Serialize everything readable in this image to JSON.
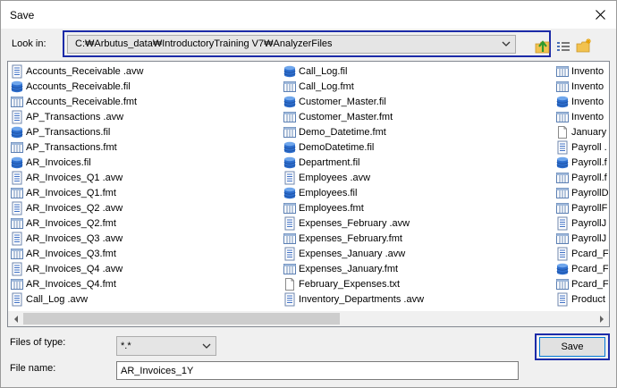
{
  "window": {
    "title": "Save"
  },
  "look_in": {
    "label": "Look in:",
    "path": "C:₩Arbutus_data₩IntroductoryTraining V7₩AnalyzerFiles"
  },
  "files": {
    "col1": [
      {
        "name": "Accounts_Receivable .avw",
        "icon": "view-document-icon"
      },
      {
        "name": "Accounts_Receivable.fil",
        "icon": "database-icon"
      },
      {
        "name": "Accounts_Receivable.fmt",
        "icon": "table-format-icon"
      },
      {
        "name": "AP_Transactions .avw",
        "icon": "view-document-icon"
      },
      {
        "name": "AP_Transactions.fil",
        "icon": "database-icon"
      },
      {
        "name": "AP_Transactions.fmt",
        "icon": "table-format-icon"
      },
      {
        "name": "AR_Invoices.fil",
        "icon": "database-icon"
      },
      {
        "name": "AR_Invoices_Q1 .avw",
        "icon": "view-document-icon"
      },
      {
        "name": "AR_Invoices_Q1.fmt",
        "icon": "table-format-icon"
      },
      {
        "name": "AR_Invoices_Q2 .avw",
        "icon": "view-document-icon"
      },
      {
        "name": "AR_Invoices_Q2.fmt",
        "icon": "table-format-icon"
      },
      {
        "name": "AR_Invoices_Q3 .avw",
        "icon": "view-document-icon"
      },
      {
        "name": "AR_Invoices_Q3.fmt",
        "icon": "table-format-icon"
      },
      {
        "name": "AR_Invoices_Q4 .avw",
        "icon": "view-document-icon"
      },
      {
        "name": "AR_Invoices_Q4.fmt",
        "icon": "table-format-icon"
      },
      {
        "name": "Call_Log .avw",
        "icon": "view-document-icon"
      }
    ],
    "col2": [
      {
        "name": "Call_Log.fil",
        "icon": "database-icon"
      },
      {
        "name": "Call_Log.fmt",
        "icon": "table-format-icon"
      },
      {
        "name": "Customer_Master.fil",
        "icon": "database-icon"
      },
      {
        "name": "Customer_Master.fmt",
        "icon": "table-format-icon"
      },
      {
        "name": "Demo_Datetime.fmt",
        "icon": "table-format-icon"
      },
      {
        "name": "DemoDatetime.fil",
        "icon": "database-icon"
      },
      {
        "name": "Department.fil",
        "icon": "database-icon"
      },
      {
        "name": "Employees .avw",
        "icon": "view-document-icon"
      },
      {
        "name": "Employees.fil",
        "icon": "database-icon"
      },
      {
        "name": "Employees.fmt",
        "icon": "table-format-icon"
      },
      {
        "name": "Expenses_February .avw",
        "icon": "view-document-icon"
      },
      {
        "name": "Expenses_February.fmt",
        "icon": "table-format-icon"
      },
      {
        "name": "Expenses_January .avw",
        "icon": "view-document-icon"
      },
      {
        "name": "Expenses_January.fmt",
        "icon": "table-format-icon"
      },
      {
        "name": "February_Expenses.txt",
        "icon": "text-file-icon"
      },
      {
        "name": "Inventory_Departments .avw",
        "icon": "view-document-icon"
      }
    ],
    "col3": [
      {
        "name": "Invento",
        "icon": "table-format-icon"
      },
      {
        "name": "Invento",
        "icon": "table-format-icon"
      },
      {
        "name": "Invento",
        "icon": "database-icon"
      },
      {
        "name": "Invento",
        "icon": "table-format-icon"
      },
      {
        "name": "January",
        "icon": "text-file-icon"
      },
      {
        "name": "Payroll .",
        "icon": "view-document-icon"
      },
      {
        "name": "Payroll.f",
        "icon": "database-icon"
      },
      {
        "name": "Payroll.f",
        "icon": "table-format-icon"
      },
      {
        "name": "PayrollD",
        "icon": "table-format-icon"
      },
      {
        "name": "PayrollF",
        "icon": "table-format-icon"
      },
      {
        "name": "PayrollJ",
        "icon": "view-document-icon"
      },
      {
        "name": "PayrollJ",
        "icon": "table-format-icon"
      },
      {
        "name": "Pcard_F",
        "icon": "view-document-icon"
      },
      {
        "name": "Pcard_F",
        "icon": "database-icon"
      },
      {
        "name": "Pcard_F",
        "icon": "table-format-icon"
      },
      {
        "name": "Product",
        "icon": "view-document-icon"
      }
    ]
  },
  "files_of_type": {
    "label": "Files of type:",
    "value": "*.*"
  },
  "file_name": {
    "label": "File name:",
    "value": "AR_Invoices_1Y"
  },
  "buttons": {
    "save": "Save"
  },
  "colors": {
    "highlight_frame": "#1c2ba8",
    "focus_border": "#0078d7"
  }
}
